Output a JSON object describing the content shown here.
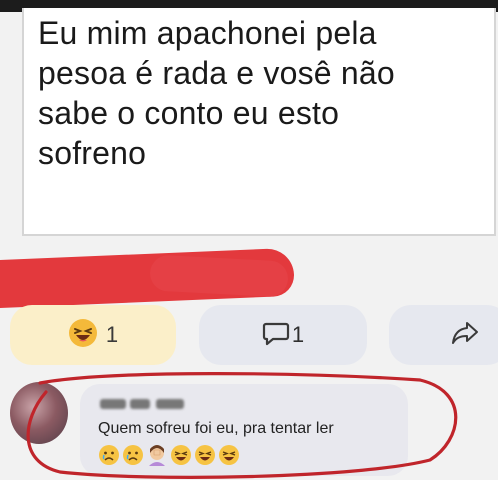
{
  "post": {
    "lines": [
      "Eu mim apachonei pela",
      "pesoa é rada e vosê não",
      "sabe o conto eu esto",
      "sofreno"
    ]
  },
  "reactions": {
    "laugh_icon": "laughing-face-icon",
    "laugh_count": "1",
    "comment_icon": "comment-bubble-icon",
    "comment_count": "1",
    "share_icon": "share-arrow-icon"
  },
  "comment": {
    "author_name_redacted": true,
    "text": "Quem sofreu foi eu, pra tentar ler",
    "emojis": [
      "crying-face",
      "crying-face",
      "facepalm-woman",
      "laughing-face",
      "laughing-face",
      "laughing-face"
    ]
  },
  "colors": {
    "scribble_red": "#e3393d",
    "ring_red": "#c0252b",
    "laugh_pill": "#fbefc9",
    "action_pill": "#e6e8ef"
  }
}
